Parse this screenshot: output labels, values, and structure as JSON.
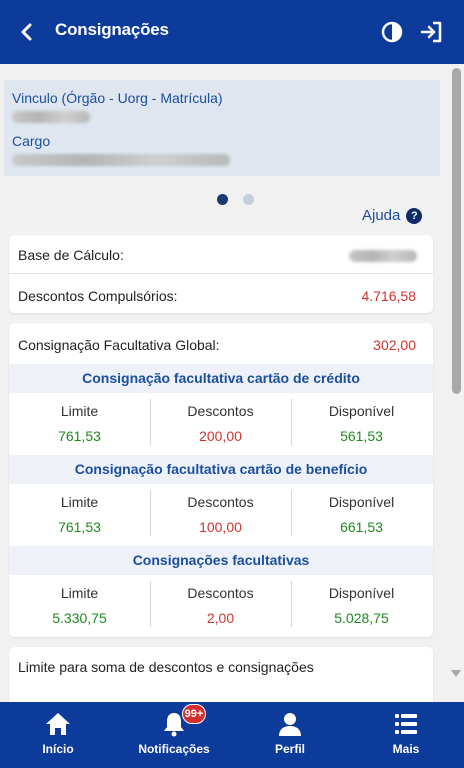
{
  "header": {
    "title": "Consignações",
    "back_icon": "arrow-left-icon",
    "contrast_icon": "contrast-icon",
    "exit_icon": "logout-icon"
  },
  "vinculo": {
    "vinculo_label": "Vinculo (Órgão - Uorg - Matrícula)",
    "cargo_label": "Cargo"
  },
  "help": {
    "label": "Ajuda",
    "icon": "help-icon"
  },
  "summary": {
    "base_label": "Base de Cálculo:",
    "descontos_label": "Descontos Compulsórios:",
    "descontos_value": "4.716,58"
  },
  "facultativa": {
    "global_label": "Consignação Facultativa Global:",
    "global_value": "302,00",
    "sections": [
      {
        "title": "Consignação facultativa cartão de crédito",
        "limite_label": "Limite",
        "limite": "761,53",
        "descontos_label": "Descontos",
        "descontos": "200,00",
        "disponivel_label": "Disponível",
        "disponivel": "561,53"
      },
      {
        "title": "Consignação facultativa cartão de benefício",
        "limite_label": "Limite",
        "limite": "761,53",
        "descontos_label": "Descontos",
        "descontos": "100,00",
        "disponivel_label": "Disponível",
        "disponivel": "661,53"
      },
      {
        "title": "Consignações facultativas",
        "limite_label": "Limite",
        "limite": "5.330,75",
        "descontos_label": "Descontos",
        "descontos": "2,00",
        "disponivel_label": "Disponível",
        "disponivel": "5.028,75"
      }
    ]
  },
  "limite_card": {
    "label": "Limite para soma de descontos e consignações"
  },
  "colors": {
    "brand": "#0d3b9c",
    "green": "#1e8a1e",
    "red": "#d0332f",
    "link": "#1a4fa0"
  },
  "tabbar": {
    "items": [
      {
        "label": "Início",
        "icon": "home-icon"
      },
      {
        "label": "Notificações",
        "icon": "bell-icon",
        "badge": "99+"
      },
      {
        "label": "Perfil",
        "icon": "user-icon"
      },
      {
        "label": "Mais",
        "icon": "menu-list-icon"
      }
    ]
  }
}
